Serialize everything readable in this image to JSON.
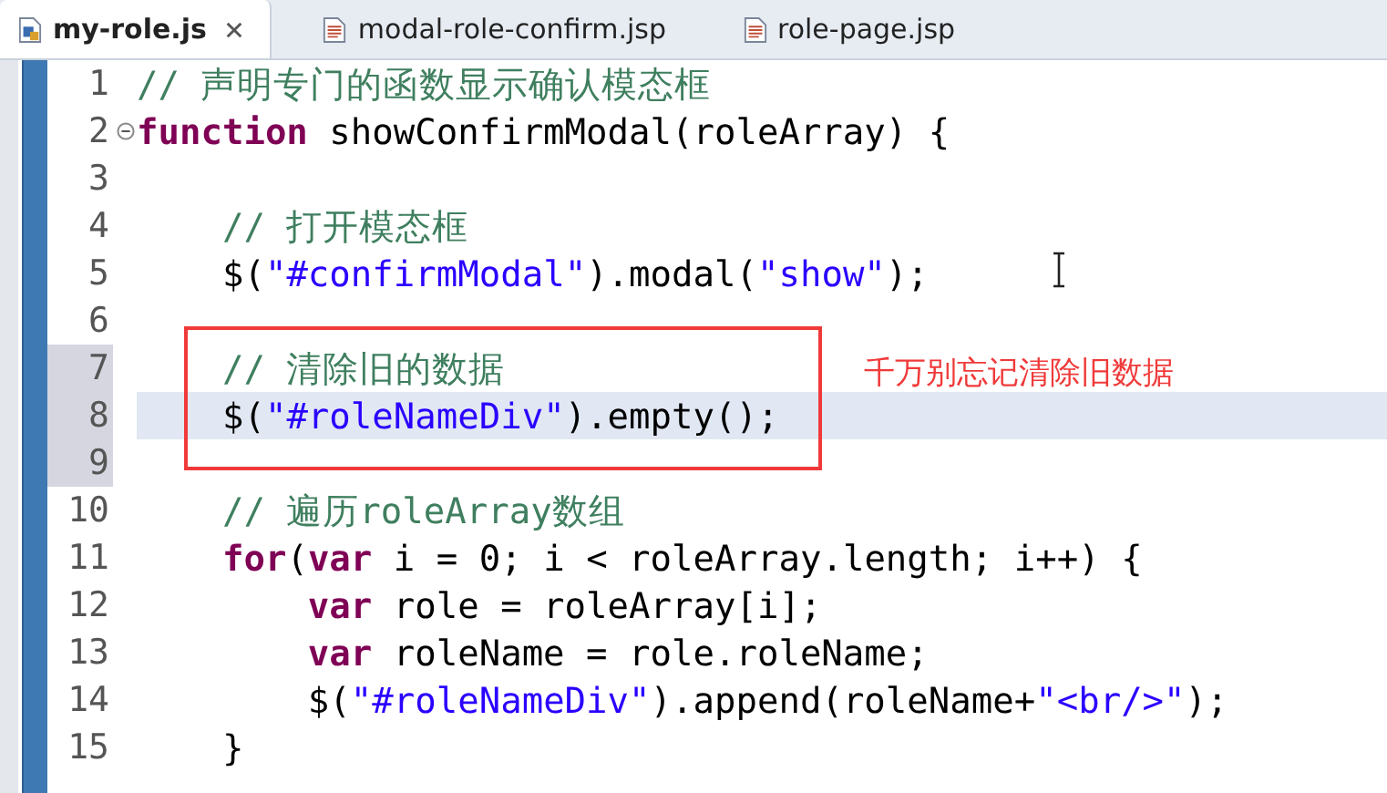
{
  "tabs": [
    {
      "label": "my-role.js",
      "kind": "js",
      "selected": true,
      "closable": true
    },
    {
      "label": "modal-role-confirm.jsp",
      "kind": "jsp",
      "selected": false,
      "closable": false
    },
    {
      "label": "role-page.jsp",
      "kind": "jsp",
      "selected": false,
      "closable": false
    }
  ],
  "lines": [
    {
      "number": "1",
      "marked": false,
      "current": false,
      "fold": false,
      "tokens": [
        {
          "kind": "comment",
          "text": "// 声明专门的函数显示确认模态框"
        }
      ]
    },
    {
      "number": "2",
      "marked": false,
      "current": false,
      "fold": true,
      "tokens": [
        {
          "kind": "keyword",
          "text": "function"
        },
        {
          "kind": "plain",
          "text": " showConfirmModal(roleArray) {"
        }
      ]
    },
    {
      "number": "3",
      "marked": false,
      "current": false,
      "fold": false
    },
    {
      "number": "4",
      "marked": false,
      "current": false,
      "fold": false,
      "tokens": [
        {
          "kind": "comment",
          "text": "    // 打开模态框"
        }
      ]
    },
    {
      "number": "5",
      "marked": false,
      "current": false,
      "fold": false,
      "tokens": [
        {
          "kind": "plain",
          "text": "    $("
        },
        {
          "kind": "string",
          "text": "\"#confirmModal\""
        },
        {
          "kind": "plain",
          "text": ").modal("
        },
        {
          "kind": "string",
          "text": "\"show\""
        },
        {
          "kind": "plain",
          "text": ");"
        }
      ]
    },
    {
      "number": "6",
      "marked": false,
      "current": false,
      "fold": false
    },
    {
      "number": "7",
      "marked": true,
      "current": false,
      "fold": false,
      "tokens": [
        {
          "kind": "comment",
          "text": "    // 清除旧的数据"
        }
      ]
    },
    {
      "number": "8",
      "marked": true,
      "current": true,
      "fold": false,
      "tokens": [
        {
          "kind": "plain",
          "text": "    $("
        },
        {
          "kind": "string",
          "text": "\"#roleNameDiv\""
        },
        {
          "kind": "plain",
          "text": ").empty();"
        }
      ]
    },
    {
      "number": "9",
      "marked": true,
      "current": false,
      "fold": false
    },
    {
      "number": "10",
      "marked": false,
      "current": false,
      "fold": false,
      "tokens": [
        {
          "kind": "comment",
          "text": "    // 遍历roleArray数组"
        }
      ]
    },
    {
      "number": "11",
      "marked": false,
      "current": false,
      "fold": false,
      "tokens": [
        {
          "kind": "keyword",
          "text": "    for"
        },
        {
          "kind": "plain",
          "text": "("
        },
        {
          "kind": "keyword",
          "text": "var"
        },
        {
          "kind": "plain",
          "text": " i = 0; i < roleArray.length; i++) {"
        }
      ]
    },
    {
      "number": "12",
      "marked": false,
      "current": false,
      "fold": false,
      "tokens": [
        {
          "kind": "keyword",
          "text": "        var"
        },
        {
          "kind": "plain",
          "text": " role = roleArray[i];"
        }
      ]
    },
    {
      "number": "13",
      "marked": false,
      "current": false,
      "fold": false,
      "tokens": [
        {
          "kind": "keyword",
          "text": "        var"
        },
        {
          "kind": "plain",
          "text": " roleName = role.roleName;"
        }
      ]
    },
    {
      "number": "14",
      "marked": false,
      "current": false,
      "fold": false,
      "tokens": [
        {
          "kind": "plain",
          "text": "        $("
        },
        {
          "kind": "string",
          "text": "\"#roleNameDiv\""
        },
        {
          "kind": "plain",
          "text": ").append(roleName+"
        },
        {
          "kind": "string",
          "text": "\"<br/>\""
        },
        {
          "kind": "plain",
          "text": ");"
        }
      ]
    },
    {
      "number": "15",
      "marked": false,
      "current": false,
      "fold": false,
      "tokens": [
        {
          "kind": "plain",
          "text": "    }"
        }
      ]
    }
  ],
  "annotation": "千万别忘记清除旧数据"
}
